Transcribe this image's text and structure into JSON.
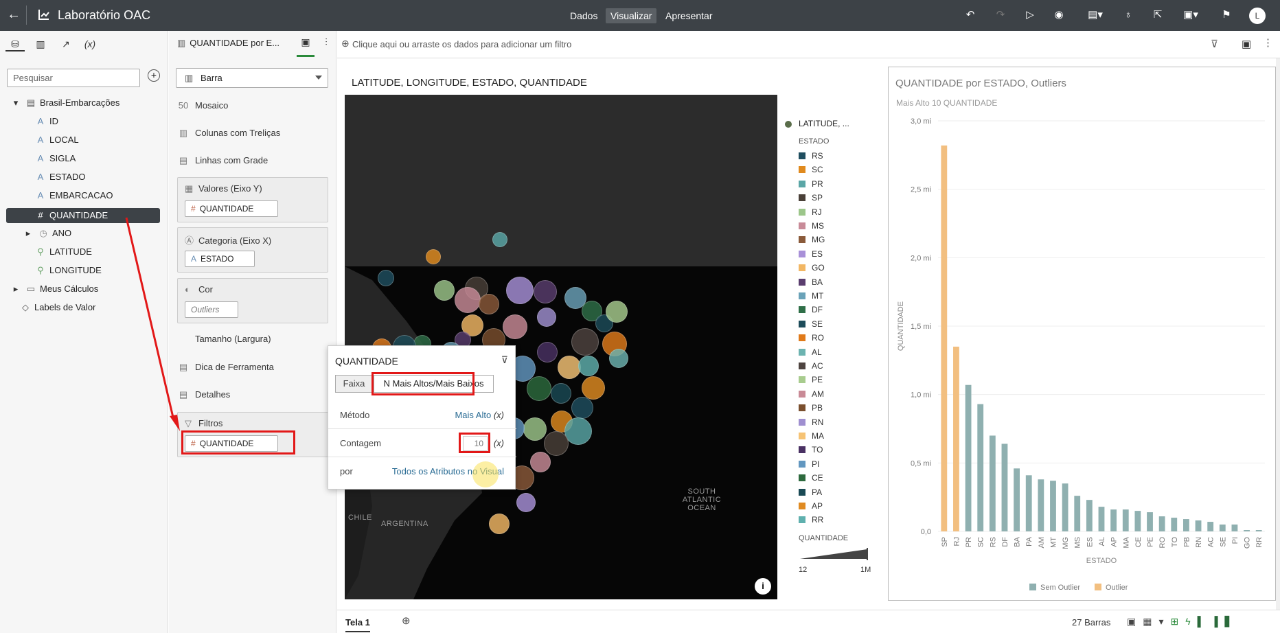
{
  "topbar": {
    "app_title": "Laboratório OAC",
    "tabs": [
      "Dados",
      "Visualizar",
      "Apresentar"
    ],
    "active_tab": "Visualizar",
    "user_initial": "L"
  },
  "left_panel": {
    "search_placeholder": "Pesquisar",
    "dataset": "Brasil-Embarcações",
    "columns": [
      "ID",
      "LOCAL",
      "SIGLA",
      "ESTADO",
      "EMBARCACAO",
      "QUANTIDADE",
      "ANO",
      "LATITUDE",
      "LONGITUDE"
    ],
    "folders": [
      "Meus Cálculos",
      "Labels de Valor"
    ]
  },
  "mid_panel": {
    "viz_name": "QUANTIDADE por E...",
    "viz_type": "Barra",
    "options": [
      "Mosaico",
      "Colunas com Treliças",
      "Linhas com Grade"
    ],
    "values_label": "Valores (Eixo Y)",
    "values_chip": "QUANTIDADE",
    "category_label": "Categoria (Eixo X)",
    "category_chip": "ESTADO",
    "color_label": "Cor",
    "color_chip": "Outliers",
    "size_label": "Tamanho (Largura)",
    "tooltip_label": "Dica de Ferramenta",
    "details_label": "Detalhes",
    "filters_label": "Filtros",
    "filters_chip": "QUANTIDADE"
  },
  "filter_bar": {
    "hint": "Clique aqui ou arraste os dados para adicionar um filtro"
  },
  "map": {
    "title": "LATITUDE, LONGITUDE, ESTADO, QUANTIDADE",
    "labels": {
      "ocean": "SOUTH\nATLANTIC\nOCEAN",
      "chile": "CHILE",
      "argentina": "ARGENTINA"
    },
    "legend_title1": "LATITUDE, ...",
    "legend_title2": "ESTADO",
    "legend_items": [
      {
        "state": "RS",
        "color": "#1f4e5f"
      },
      {
        "state": "SC",
        "color": "#e08a1e"
      },
      {
        "state": "PR",
        "color": "#5aa6a6"
      },
      {
        "state": "SP",
        "color": "#4a4038"
      },
      {
        "state": "RJ",
        "color": "#9cc68a"
      },
      {
        "state": "MS",
        "color": "#c88b98"
      },
      {
        "state": "MG",
        "color": "#8a5a3a"
      },
      {
        "state": "ES",
        "color": "#a890d8"
      },
      {
        "state": "GO",
        "color": "#f2b764"
      },
      {
        "state": "BA",
        "color": "#5a3d6e"
      },
      {
        "state": "MT",
        "color": "#6aa2b8"
      },
      {
        "state": "DF",
        "color": "#2f6f48"
      },
      {
        "state": "SE",
        "color": "#1d4c5a"
      },
      {
        "state": "RO",
        "color": "#e07a1a"
      },
      {
        "state": "AL",
        "color": "#6cb3b0"
      },
      {
        "state": "AC",
        "color": "#4e4440"
      },
      {
        "state": "PE",
        "color": "#a8cc8e"
      },
      {
        "state": "AM",
        "color": "#c98a96"
      },
      {
        "state": "PB",
        "color": "#7a4f2e"
      },
      {
        "state": "RN",
        "color": "#9f8fd0"
      },
      {
        "state": "MA",
        "color": "#f6c375"
      },
      {
        "state": "TO",
        "color": "#4a3163"
      },
      {
        "state": "PI",
        "color": "#6297c0"
      },
      {
        "state": "CE",
        "color": "#2d6a3e"
      },
      {
        "state": "PA",
        "color": "#1a4a55"
      },
      {
        "state": "AP",
        "color": "#e08b22"
      },
      {
        "state": "RR",
        "color": "#5fb0ae"
      }
    ],
    "size_legend_title": "QUANTIDADE",
    "size_min": "12",
    "size_max": "1M"
  },
  "popup": {
    "title": "QUANTIDADE",
    "seg_range": "Faixa",
    "seg_topn": "N Mais Altos/Mais Baixos",
    "method_label": "Método",
    "method_value": "Mais Alto",
    "count_label": "Contagem",
    "count_value": "10",
    "by_label": "por",
    "by_value": "Todos os Atributos no Visual",
    "fx": "(x)"
  },
  "chart_data": {
    "type": "bar",
    "title": "QUANTIDADE por ESTADO, Outliers",
    "subtitle": "Mais Alto 10 QUANTIDADE",
    "xlabel": "ESTADO",
    "ylabel": "QUANTIDADE",
    "categories": [
      "SP",
      "RJ",
      "PR",
      "SC",
      "RS",
      "DF",
      "BA",
      "PA",
      "AM",
      "MT",
      "MG",
      "MS",
      "ES",
      "AL",
      "AP",
      "MA",
      "CE",
      "PE",
      "RO",
      "TO",
      "PB",
      "RN",
      "AC",
      "SE",
      "PI",
      "GO",
      "RR"
    ],
    "values": [
      2.82,
      1.35,
      1.07,
      0.93,
      0.7,
      0.64,
      0.46,
      0.41,
      0.38,
      0.37,
      0.35,
      0.26,
      0.23,
      0.18,
      0.16,
      0.16,
      0.15,
      0.14,
      0.11,
      0.1,
      0.09,
      0.08,
      0.07,
      0.05,
      0.05,
      0.01,
      0.01
    ],
    "outlier": [
      true,
      true,
      false,
      false,
      false,
      false,
      false,
      false,
      false,
      false,
      false,
      false,
      false,
      false,
      false,
      false,
      false,
      false,
      false,
      false,
      false,
      false,
      false,
      false,
      false,
      false,
      false
    ],
    "yticks": [
      "0,0",
      "0,5 mi",
      "1,0 mi",
      "1,5 mi",
      "2,0 mi",
      "2,5 mi",
      "3,0 mi"
    ],
    "ylim": [
      0,
      3.0
    ],
    "colors": {
      "normal": "#8fb0b0",
      "outlier": "#f2bf80"
    },
    "legend": [
      "Sem Outlier",
      "Outlier"
    ]
  },
  "bottom": {
    "tab": "Tela 1",
    "bar_count": "27 Barras"
  }
}
